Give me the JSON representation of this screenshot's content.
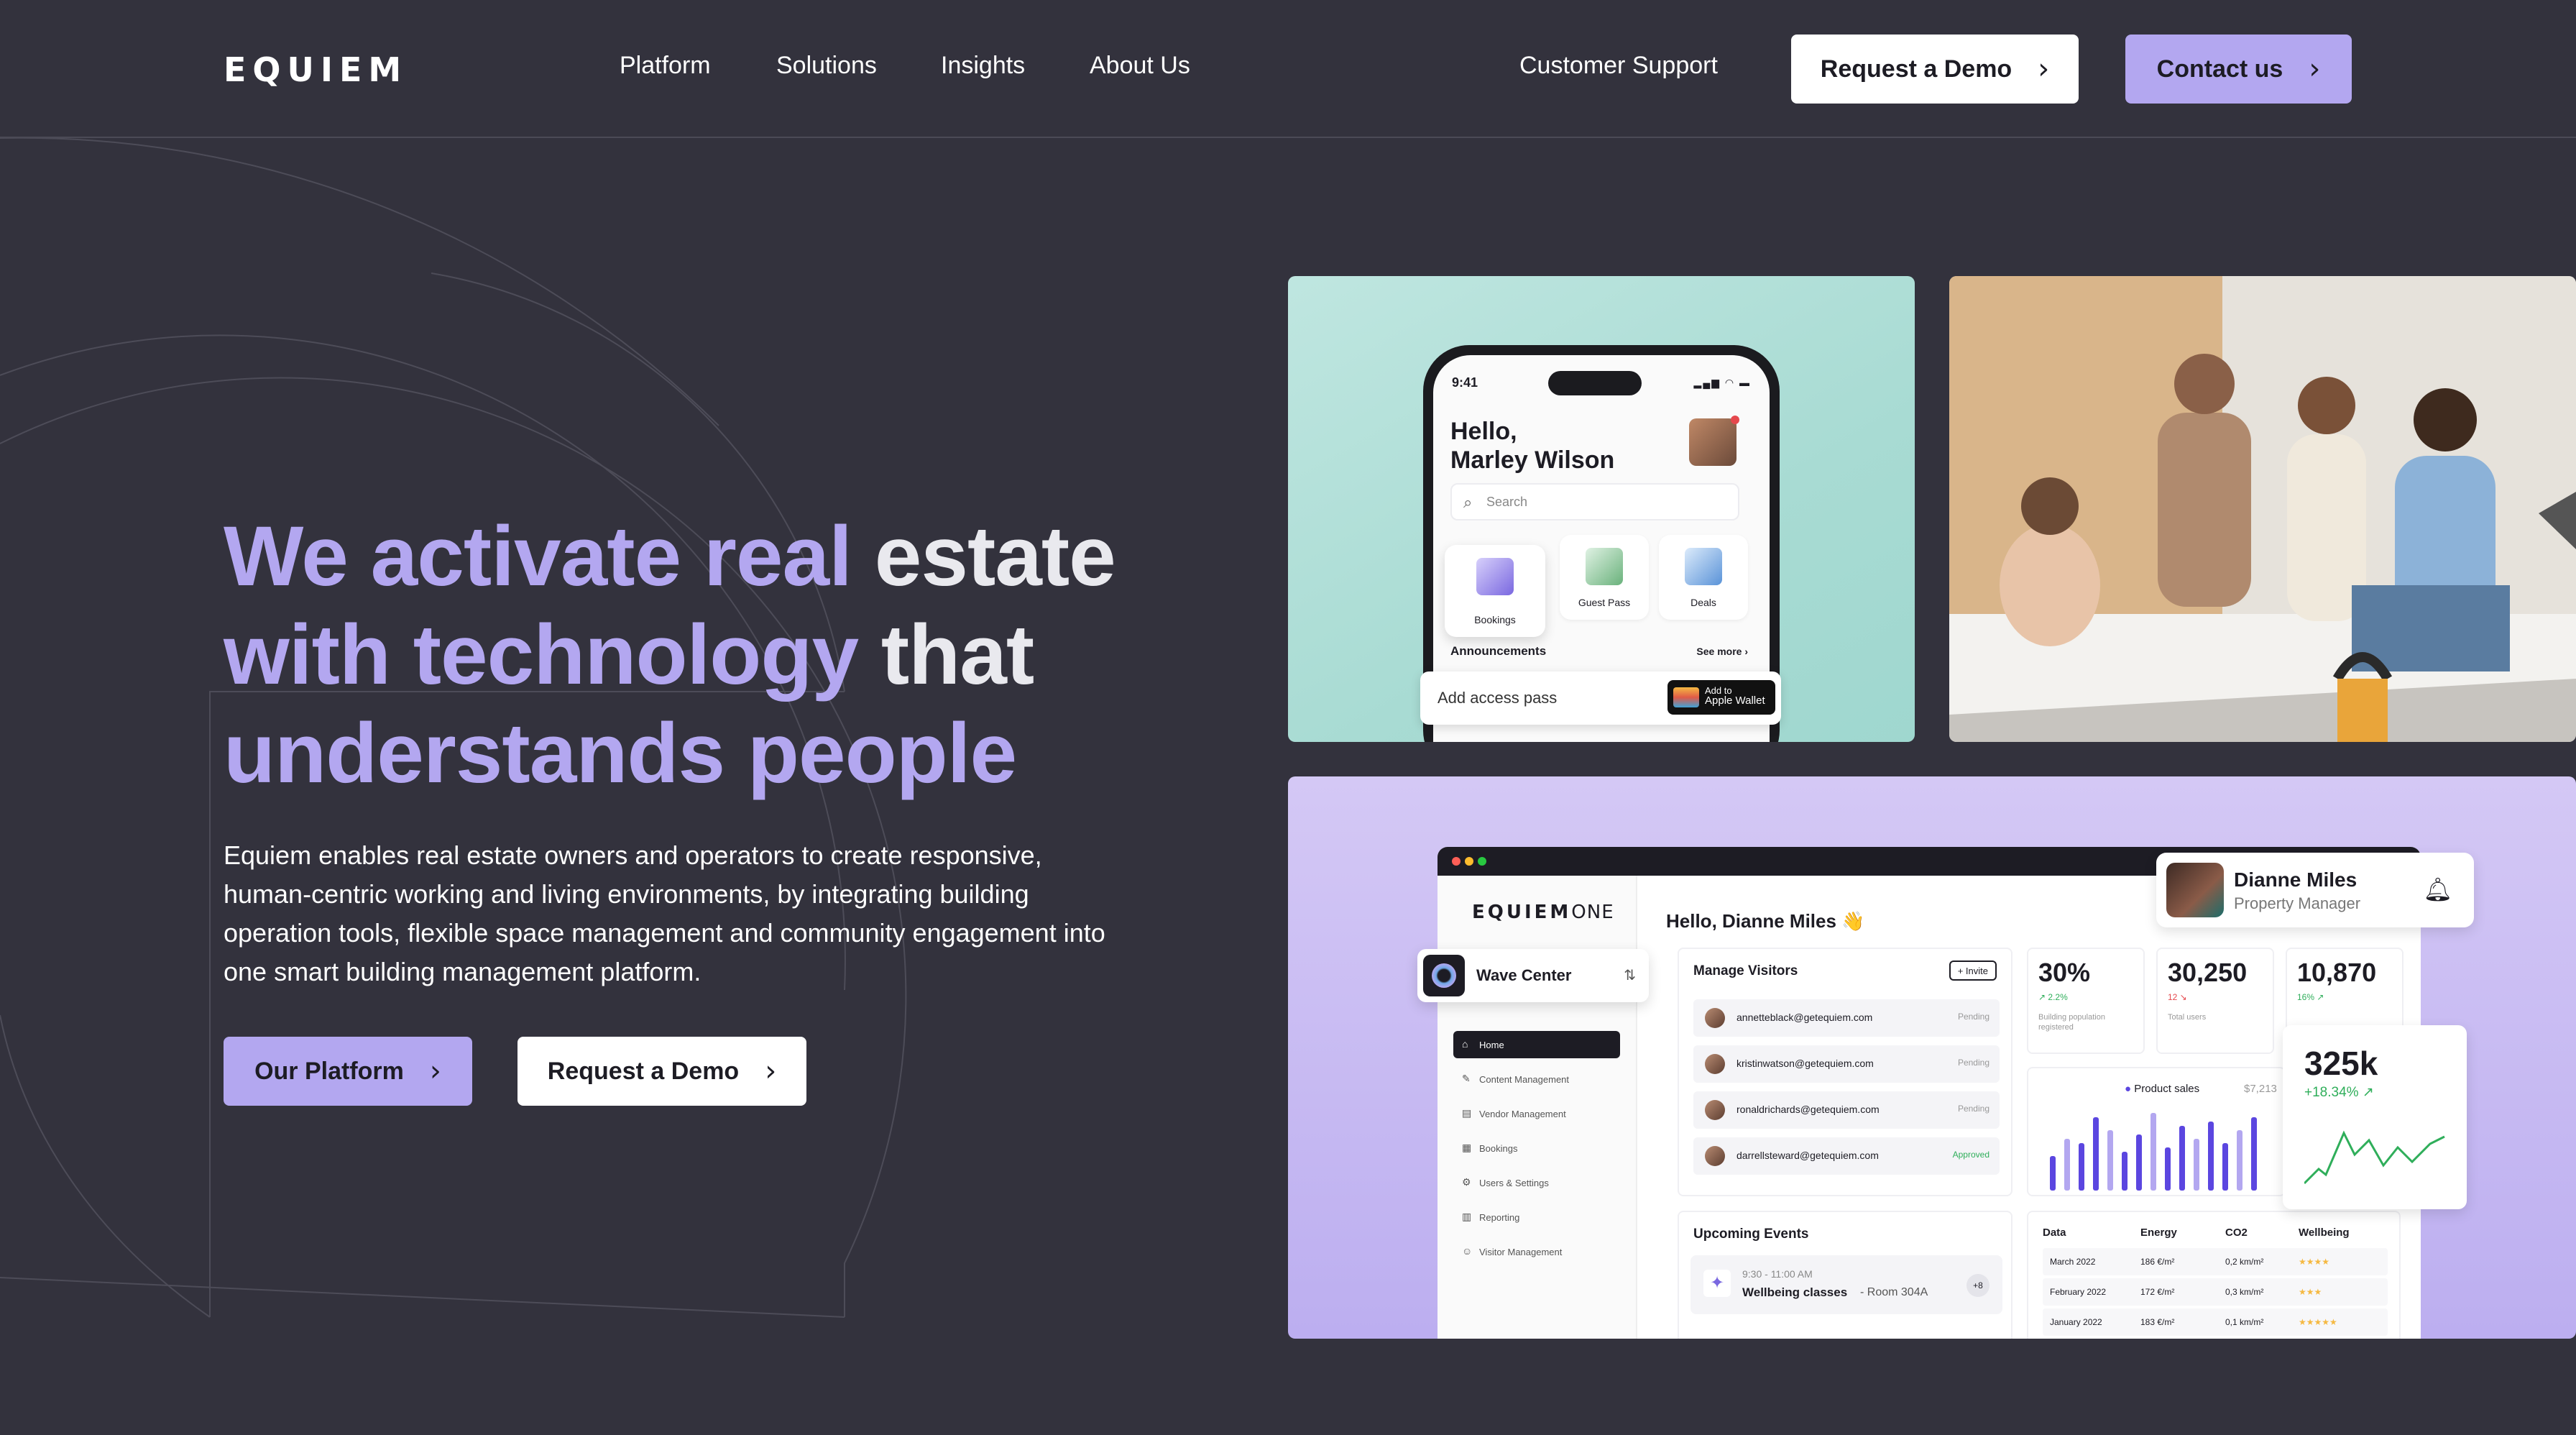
{
  "header": {
    "logo": "EQUIEM",
    "nav": [
      "Platform",
      "Solutions",
      "Insights",
      "About Us"
    ],
    "support": "Customer Support",
    "demo_button": "Request a Demo",
    "contact_button": "Contact us"
  },
  "hero": {
    "headline": {
      "l1a": "We activate real ",
      "l1b": "estate",
      "l2a": "with ",
      "l2b": "technology",
      "l2c": " that",
      "l3": "understands people"
    },
    "paragraph": "Equiem enables real estate owners and operators to create responsive, human-centric working and living environments, by integrating building operation tools, flexible space management and community engagement into one smart building management platform.",
    "platform_button": "Our Platform",
    "demo_button": "Request a Demo"
  },
  "phone": {
    "time": "9:41",
    "greeting_1": "Hello,",
    "greeting_2": "Marley Wilson",
    "search_placeholder": "Search",
    "tiles": [
      "Bookings",
      "Guest Pass",
      "Deals"
    ],
    "announcements": "Announcements",
    "see_more": "See more",
    "access_pass": "Add access pass",
    "wallet_line1": "Add to",
    "wallet_line2": "Apple Wallet"
  },
  "dashboard": {
    "logo_bold": "EQUIEM",
    "logo_light": "ONE",
    "greeting": "Hello, Dianne Miles 👋",
    "profile_name": "Dianne Miles",
    "profile_role": "Property Manager",
    "building": "Wave Center",
    "menu": [
      "Home",
      "Content Management",
      "Vendor Management",
      "Bookings",
      "Users & Settings",
      "Reporting",
      "Visitor Management"
    ],
    "visitors_title": "Manage Visitors",
    "invite": "+ Invite",
    "visitors": [
      {
        "email": "annetteblack@getequiem.com",
        "status": "Pending"
      },
      {
        "email": "kristinwatson@getequiem.com",
        "status": "Pending"
      },
      {
        "email": "ronaldrichards@getequiem.com",
        "status": "Pending"
      },
      {
        "email": "darrellsteward@getequiem.com",
        "status": "Approved"
      }
    ],
    "stats": [
      {
        "value": "30%",
        "delta": "↗ 2.2%",
        "label": "Building population registered"
      },
      {
        "value": "30,250",
        "delta": "12 ↘",
        "label": "Total users"
      },
      {
        "value": "10,870",
        "delta": "16% ↗",
        "label": ""
      }
    ],
    "sales_legend": "Product sales",
    "sales_value": "$7,213",
    "big_value": "325k",
    "big_delta": "+18.34% ↗",
    "events_title": "Upcoming Events",
    "event_time": "9:30 - 11:00 AM",
    "event_name": "Wellbeing classes",
    "event_room": " - Room 304A",
    "event_more": "+8",
    "table_headers": [
      "Data",
      "Energy",
      "CO2",
      "Wellbeing"
    ],
    "table_rows": [
      [
        "March 2022",
        "186 €/m²",
        "0,2 km/m²",
        "★★★★"
      ],
      [
        "February 2022",
        "172 €/m²",
        "0,3 km/m²",
        "★★★"
      ],
      [
        "January 2022",
        "183 €/m²",
        "0,1 km/m²",
        "★★★★★"
      ]
    ]
  },
  "colors": {
    "background": "#33323d",
    "accent_purple": "#b3a7f0",
    "white": "#ffffff"
  },
  "chart_data": {
    "type": "bar",
    "series": [
      {
        "name": "Product sales",
        "values": [
          40,
          60,
          55,
          85,
          70,
          45,
          65,
          90,
          50,
          75,
          60,
          80,
          55,
          70,
          85
        ]
      }
    ]
  }
}
